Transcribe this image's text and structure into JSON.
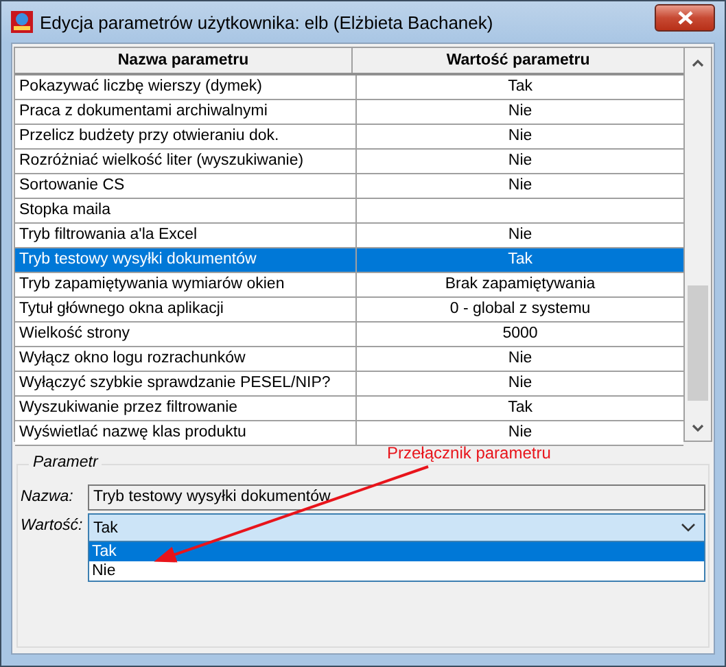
{
  "window": {
    "title": "Edycja parametrów użytkownika: elb (Elżbieta Bachanek)"
  },
  "table": {
    "columns": [
      "Nazwa parametru",
      "Wartość parametru"
    ],
    "rows": [
      {
        "name": "Pokazywać liczbę wierszy (dymek)",
        "value": "Tak",
        "selected": false
      },
      {
        "name": "Praca z dokumentami archiwalnymi",
        "value": "Nie",
        "selected": false
      },
      {
        "name": "Przelicz budżety przy otwieraniu dok.",
        "value": "Nie",
        "selected": false
      },
      {
        "name": "Rozróżniać wielkość liter (wyszukiwanie)",
        "value": "Nie",
        "selected": false
      },
      {
        "name": "Sortowanie CS",
        "value": "Nie",
        "selected": false
      },
      {
        "name": "Stopka maila",
        "selected": false
      },
      {
        "name": "Tryb filtrowania a'la Excel",
        "value": "Nie",
        "selected": false
      },
      {
        "name": "Tryb testowy wysyłki dokumentów",
        "value": "Tak",
        "selected": true
      },
      {
        "name": "Tryb zapamiętywania wymiarów okien",
        "value": "Brak zapamiętywania",
        "selected": false
      },
      {
        "name": "Tytuł głównego okna aplikacji",
        "value": "0 - global z systemu",
        "selected": false
      },
      {
        "name": "Wielkość strony",
        "value": "5000",
        "selected": false
      },
      {
        "name": "Wyłącz okno logu rozrachunków",
        "value": "Nie",
        "selected": false
      },
      {
        "name": "Wyłączyć szybkie sprawdzanie PESEL/NIP?",
        "value": "Nie",
        "selected": false
      },
      {
        "name": "Wyszukiwanie przez filtrowanie",
        "value": "Tak",
        "selected": false
      },
      {
        "name": "Wyświetlać nazwę klas produktu",
        "value": "Nie",
        "selected": false
      }
    ]
  },
  "parameter": {
    "title": "Parametr",
    "name_label": "Nazwa:",
    "name_value": "Tryb testowy wysyłki dokumentów",
    "value_label": "Wartość:",
    "value": "Tak",
    "options": [
      {
        "label": "Tak",
        "selected": true
      },
      {
        "label": "Nie",
        "selected": false
      }
    ]
  },
  "annotation": {
    "text": "Przełącznik parametru"
  }
}
